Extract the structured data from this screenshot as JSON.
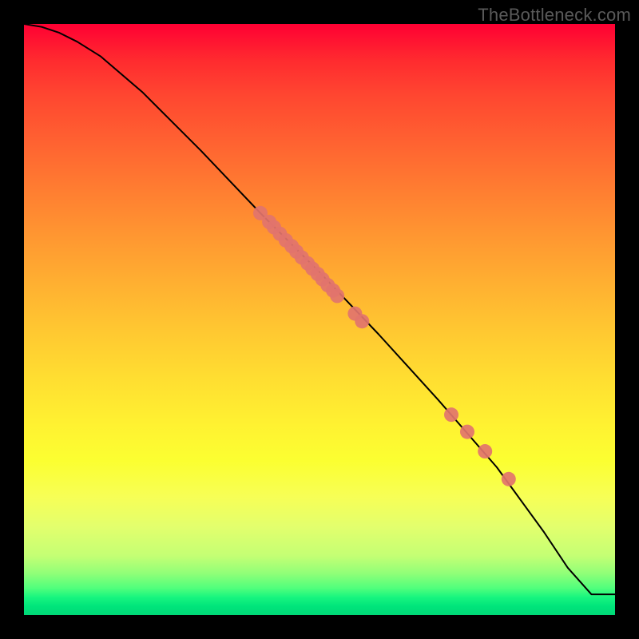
{
  "watermark": "TheBottleneck.com",
  "chart_data": {
    "type": "line",
    "title": "",
    "xlabel": "",
    "ylabel": "",
    "xlim": [
      0,
      100
    ],
    "ylim": [
      0,
      100
    ],
    "curve": {
      "x": [
        0,
        3,
        6,
        9,
        13,
        20,
        30,
        40,
        50,
        60,
        70,
        80,
        88,
        92,
        96,
        100
      ],
      "y": [
        100,
        99.5,
        98.5,
        97,
        94.5,
        88.5,
        78.5,
        68,
        58,
        47.5,
        36.5,
        25,
        14,
        8,
        3.5,
        3.5
      ]
    },
    "points": {
      "x": [
        40.0,
        41.5,
        42.3,
        43.3,
        44.3,
        45.3,
        46.1,
        47.0,
        48.0,
        48.8,
        49.7,
        50.5,
        51.4,
        52.3,
        53.0,
        56.0,
        57.2,
        72.3,
        75.0,
        78.0,
        82.0
      ],
      "y": [
        68.0,
        66.5,
        65.6,
        64.5,
        63.4,
        62.4,
        61.5,
        60.5,
        59.5,
        58.6,
        57.7,
        56.8,
        55.8,
        54.9,
        54.0,
        51.0,
        49.7,
        33.9,
        31.0,
        27.7,
        23.0
      ]
    },
    "point_style": {
      "color": "#e2746c",
      "radius": 9
    },
    "line_style": {
      "color": "#000000",
      "width": 2
    }
  }
}
